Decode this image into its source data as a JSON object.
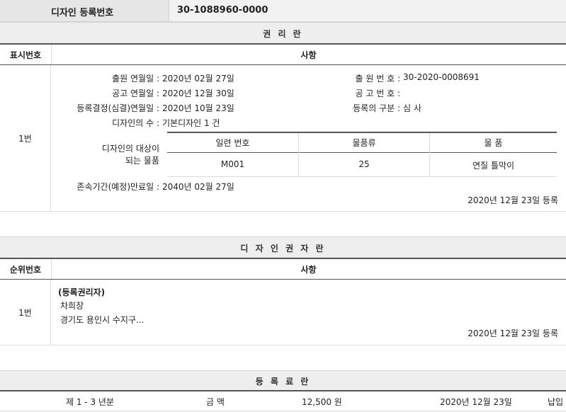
{
  "header": {
    "label": "디자인 등록번호",
    "value": "30-1088960-0000"
  },
  "rights": {
    "title": "권 리 란",
    "col_no": "표시번호",
    "col_item": "사항",
    "row_no": "1번",
    "fields": {
      "app_date_label": "출원 연월일 :",
      "app_date": "2020년 02월 27일",
      "app_no_label": "출 원 번 호 :",
      "app_no": "30-2020-0008691",
      "pub_date_label": "공고 연월일 :",
      "pub_date": "2020년 12월 30일",
      "pub_no_label": "공 고 번 호 :",
      "pub_no": "",
      "dec_date_label": "등록결정(심결)연월일 :",
      "dec_date": "2020년 10월 23일",
      "reg_type_label": "등록의 구분 :",
      "reg_type": "심 사",
      "count_label": "디자인의 수 :",
      "count": "기본디자인 1 건",
      "target_label_1": "디자인의 대상이",
      "target_label_2": "되는 물품",
      "expiry_label": "존속기간(예정)만료일 :",
      "expiry": "2040년 02월 27일",
      "reg_stamp": "2020년 12월 23일 등록"
    },
    "goods_table": {
      "headers": [
        "일련 번호",
        "물품류",
        "물 품"
      ],
      "rows": [
        [
          "M001",
          "25",
          "연질 틀막이"
        ]
      ]
    }
  },
  "holder": {
    "title": "디 자 인 권 자 란",
    "col_no": "순위번호",
    "col_item": "사항",
    "row_no": "1번",
    "type": "(등록권리자)",
    "name": "차희장",
    "address": "경기도 용인시 수지구...",
    "reg_stamp": "2020년 12월 23일 등록"
  },
  "fees": {
    "title": "등 록 료 란",
    "period": "제 1 - 3 년분",
    "amount_label": "금 액",
    "amount": "12,500 원",
    "date": "2020년 12월 23일",
    "status": "납입"
  }
}
